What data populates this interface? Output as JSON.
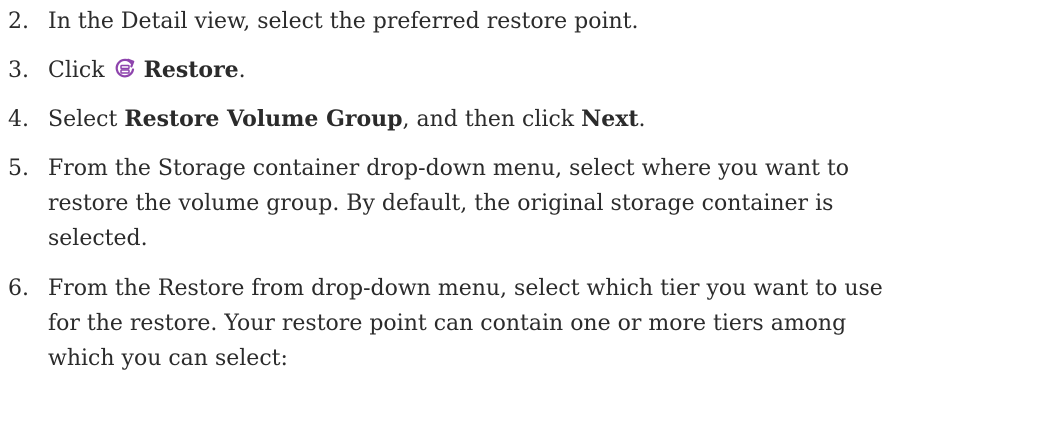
{
  "steps": [
    {
      "number": "2.",
      "text": "In the Detail view, select the preferred restore point."
    },
    {
      "number": "3.",
      "before": "Click",
      "icon": "restore-icon",
      "bold": "Restore",
      "after": "."
    },
    {
      "number": "4.",
      "before": "Select ",
      "bold1": "Restore Volume Group",
      "middle": ", and then click ",
      "bold2": "Next",
      "after": "."
    },
    {
      "number": "5.",
      "lines": [
        "From the Storage container drop-down menu, select where you want to",
        "restore the volume group. By default, the original storage container is",
        "selected."
      ]
    },
    {
      "number": "6.",
      "lines": [
        "From the Restore from drop-down menu, select which tier you want to use",
        "for the restore. Your restore point can contain one or more tiers among",
        "which you can select:"
      ]
    }
  ],
  "colors": {
    "text": "#2b2b2b",
    "icon_accent": "#8e44ad"
  }
}
